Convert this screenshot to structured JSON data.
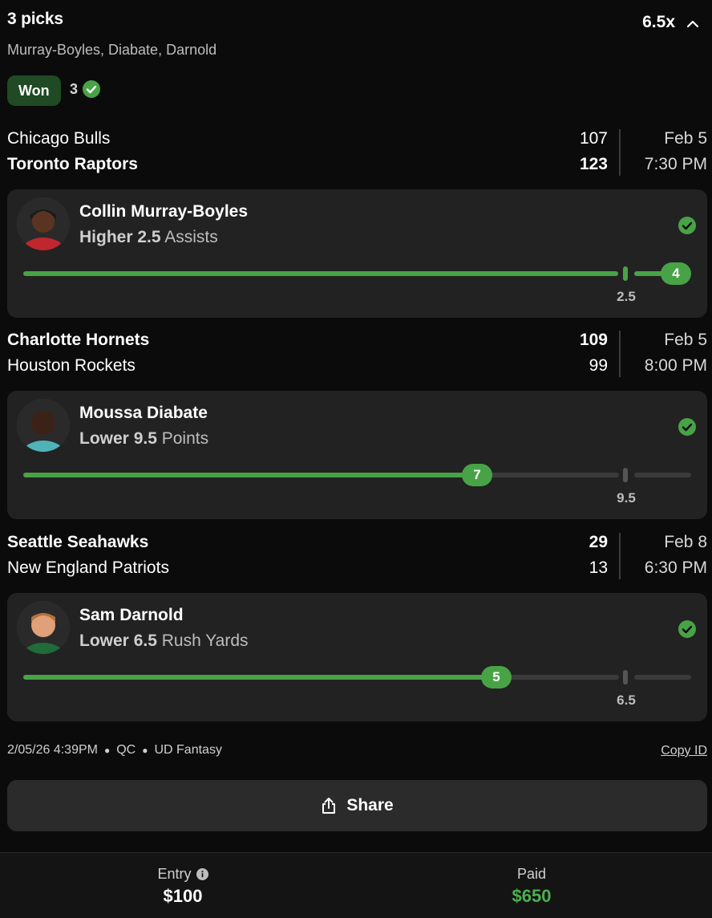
{
  "header": {
    "title": "3 picks",
    "multiplier": "6.5x",
    "players": "Murray-Boyles, Diabate, Darnold",
    "status": "Won",
    "won_count": "3"
  },
  "games": [
    {
      "team1": "Chicago Bulls",
      "score1": "107",
      "team2": "Toronto Raptors",
      "score2": "123",
      "date": "Feb 5",
      "time": "7:30 PM",
      "pick": {
        "player": "Collin Murray-Boyles",
        "direction": "Higher",
        "line": "2.5",
        "stat": "Assists",
        "actual": "4",
        "progress": 1.0
      }
    },
    {
      "team1": "Charlotte Hornets",
      "score1": "109",
      "team2": "Houston Rockets",
      "score2": "99",
      "date": "Feb 5",
      "time": "8:00 PM",
      "pick": {
        "player": "Moussa Diabate",
        "direction": "Lower",
        "line": "9.5",
        "stat": "Points",
        "actual": "7",
        "progress": 0.74
      }
    },
    {
      "team1": "Seattle Seahawks",
      "score1": "29",
      "team2": "New England Patriots",
      "score2": "13",
      "date": "Feb 8",
      "time": "6:30 PM",
      "pick": {
        "player": "Sam Darnold",
        "direction": "Lower",
        "line": "6.5",
        "stat": "Rush Yards",
        "actual": "5",
        "progress": 0.77
      }
    }
  ],
  "meta": {
    "datetime": "2/05/26 4:39PM",
    "region": "QC",
    "product": "UD Fantasy",
    "copy_id": "Copy ID"
  },
  "share_label": "Share",
  "footer": {
    "entry_label": "Entry",
    "entry_value": "$100",
    "paid_label": "Paid",
    "paid_value": "$650"
  },
  "colors": {
    "accent_green": "#48a346",
    "badge_green": "#1f4a23",
    "card_bg": "#222222",
    "page_bg": "#0b0b0b"
  }
}
